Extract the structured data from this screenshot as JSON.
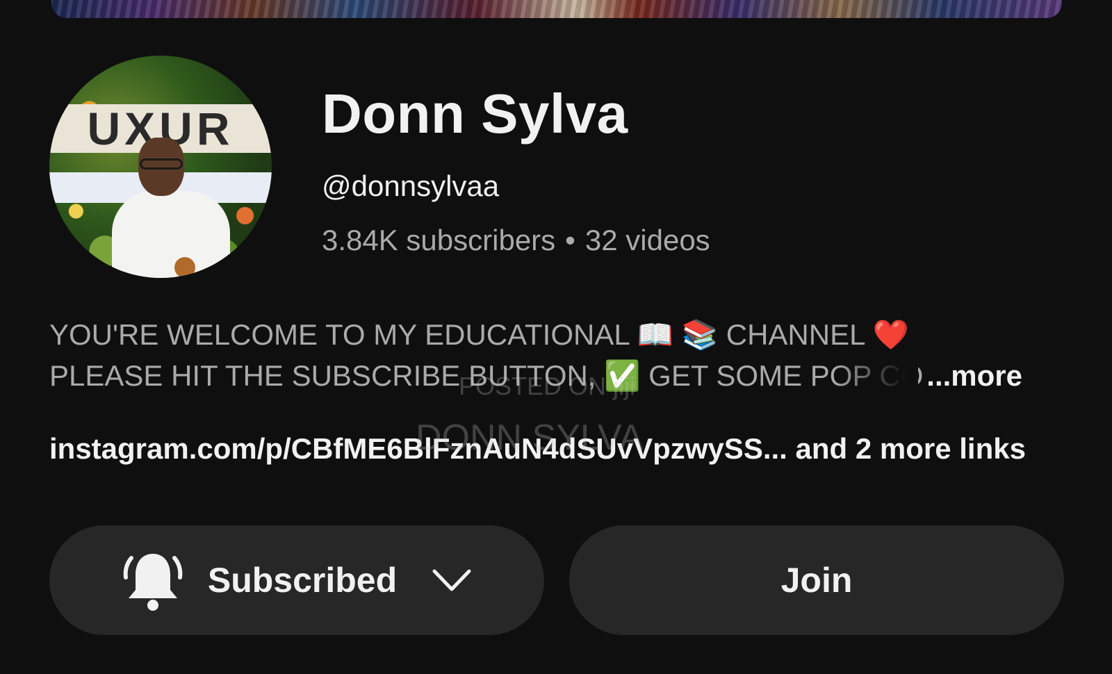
{
  "channel": {
    "name": "Donn Sylva",
    "handle": "@donnsylvaa",
    "subscribers": "3.84K subscribers",
    "separator": "•",
    "videos": "32 videos",
    "avatar_sign_text": "UXUR"
  },
  "description": {
    "line1": "YOU'RE WELCOME TO MY  EDUCATIONAL 📖 📚  CHANNEL ❤️",
    "line2": "PLEASE HIT THE SUBSCRIBE BUTTON, ✅ GET SOME POP CORN",
    "more_label": "...more"
  },
  "links": {
    "text": "instagram.com/p/CBfME6BlFznAuN4dSUvVpzwySS... and 2 more links"
  },
  "watermark": {
    "line1": "POSTED ON jiji",
    "line2": "DONN SYLVA"
  },
  "actions": {
    "subscribed_label": "Subscribed",
    "join_label": "Join"
  },
  "icons": {
    "notification": "bell-icon",
    "dropdown": "chevron-down-icon"
  },
  "colors": {
    "background": "#0f0f0f",
    "button_bg": "#272727",
    "primary_text": "#f1f1f1",
    "secondary_text": "#aaaaaa"
  }
}
